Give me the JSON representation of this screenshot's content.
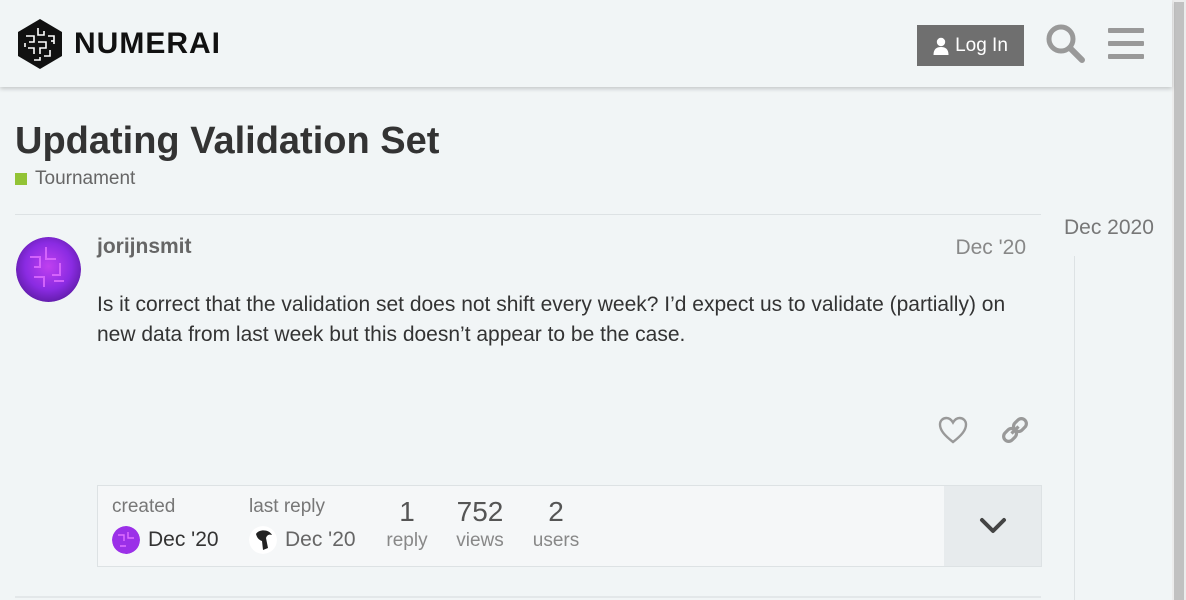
{
  "header": {
    "logo_text": "NUMERAI",
    "login_label": "Log In",
    "icons": [
      "user-icon",
      "search-icon",
      "hamburger-menu-icon"
    ]
  },
  "topic": {
    "title": "Updating Validation Set",
    "category": "Tournament",
    "category_color": "#92c335"
  },
  "post": {
    "username": "jorijnsmit",
    "date": "Dec '20",
    "body": "Is it correct that the validation set does not shift every week? I’d expect us to validate (partially) on new data from last week but this doesn’t appear to be the case."
  },
  "summary": {
    "created_label": "created",
    "created_date": "Dec '20",
    "last_reply_label": "last reply",
    "last_reply_date": "Dec '20",
    "stats": [
      {
        "num": "1",
        "label": "reply"
      },
      {
        "num": "752",
        "label": "views"
      },
      {
        "num": "2",
        "label": "users"
      }
    ]
  },
  "timeline": {
    "date": "Dec 2020"
  }
}
